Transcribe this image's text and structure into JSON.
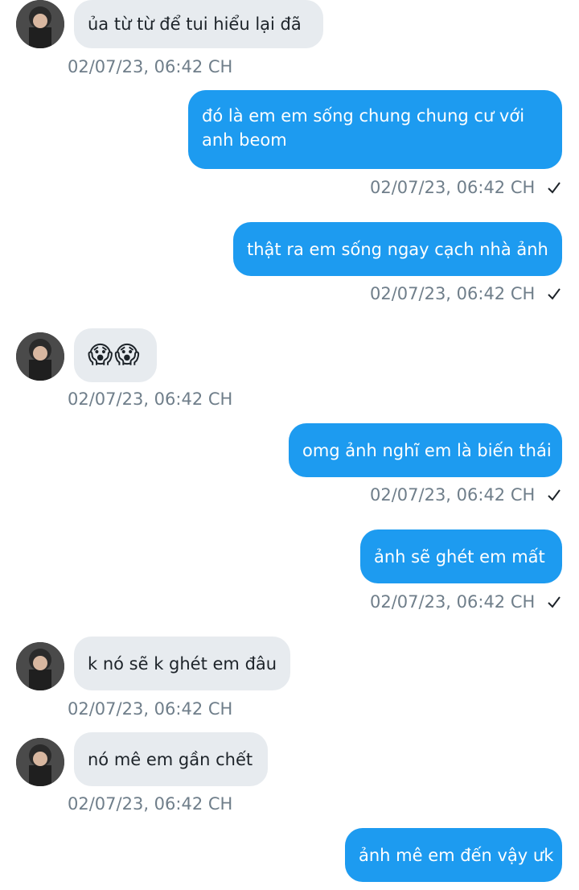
{
  "messages": [
    {
      "direction": "in",
      "text": "ủa từ từ để tui hiểu lại đã",
      "time": "02/07/23, 06:42 CH"
    },
    {
      "direction": "out",
      "text": "đó là em em sống chung chung cư với anh beom",
      "time": "02/07/23, 06:42 CH"
    },
    {
      "direction": "out",
      "text": "thật ra em sống ngay cạch nhà ảnh",
      "time": "02/07/23, 06:42 CH"
    },
    {
      "direction": "in",
      "text": "😱😱",
      "time": "02/07/23, 06:42 CH"
    },
    {
      "direction": "out",
      "text": "omg ảnh nghĩ em là biến thái",
      "time": "02/07/23, 06:42 CH"
    },
    {
      "direction": "out",
      "text": "ảnh sẽ ghét em mất",
      "time": "02/07/23, 06:42 CH"
    },
    {
      "direction": "in",
      "text": "k nó sẽ k ghét em đâu",
      "time": "02/07/23, 06:42 CH"
    },
    {
      "direction": "in",
      "text": "nó mê em gần chết",
      "time": "02/07/23, 06:42 CH"
    },
    {
      "direction": "out",
      "text": "ảnh mê em đến vậy ưk",
      "time": ""
    }
  ],
  "icons": {
    "avatar": "user-avatar-icon",
    "read_receipt": "checkmark-icon"
  },
  "colors": {
    "outgoing": "#1d9bf0",
    "incoming": "#e7ebef",
    "timestamp": "#6f7e8a"
  }
}
